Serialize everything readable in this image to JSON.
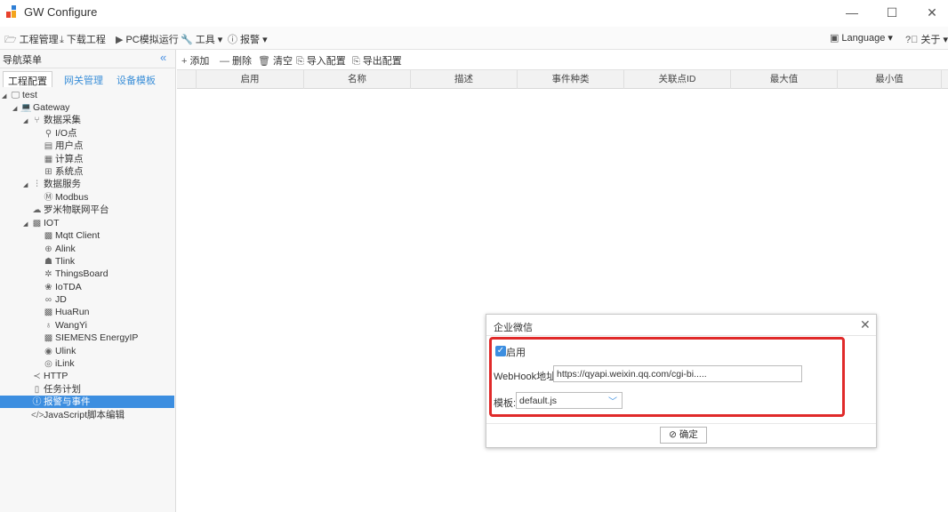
{
  "window": {
    "title": "GW Configure",
    "controls": {
      "minimize": "—",
      "maximize": "☐",
      "close": "✕"
    }
  },
  "menubar": {
    "project": "工程管理",
    "download": "下载工程",
    "pc_sim": "PC模拟运行",
    "tools": "工具",
    "alarm": "报警",
    "language": "Language",
    "about": "关于"
  },
  "nav": {
    "title": "导航菜单",
    "collapse": "«",
    "tabs": [
      "工程配置",
      "网关管理",
      "设备模板"
    ],
    "tree": [
      {
        "label": "test"
      },
      {
        "label": "Gateway"
      },
      {
        "label": "数据采集"
      },
      {
        "label": "I/O点"
      },
      {
        "label": "用户点"
      },
      {
        "label": "计算点"
      },
      {
        "label": "系统点"
      },
      {
        "label": "数据服务"
      },
      {
        "label": "Modbus"
      },
      {
        "label": "罗米物联网平台"
      },
      {
        "label": "IOT"
      },
      {
        "label": "Mqtt Client"
      },
      {
        "label": "Alink"
      },
      {
        "label": "Tlink"
      },
      {
        "label": "ThingsBoard"
      },
      {
        "label": "IoTDA"
      },
      {
        "label": "JD"
      },
      {
        "label": "HuaRun"
      },
      {
        "label": "WangYi"
      },
      {
        "label": "SIEMENS EnergyIP"
      },
      {
        "label": "Ulink"
      },
      {
        "label": "iLink"
      },
      {
        "label": "HTTP"
      },
      {
        "label": "任务计划"
      },
      {
        "label": "报警与事件"
      },
      {
        "label": "JavaScript脚本编辑"
      }
    ]
  },
  "toolbar": {
    "add": "添加",
    "delete": "删除",
    "clear": "清空",
    "import": "导入配置",
    "export": "导出配置"
  },
  "table": {
    "columns": [
      "启用",
      "名称",
      "描述",
      "事件种类",
      "关联点ID",
      "最大值",
      "最小值"
    ]
  },
  "dialog": {
    "title": "企业微信",
    "close": "✕",
    "enable_label": "启用",
    "enable_checked": true,
    "webhook_label": "WebHook地址:",
    "webhook_value": "https://qyapi.weixin.qq.com/cgi-bi.....",
    "template_label": "模板:",
    "template_value": "default.js",
    "ok": "确定"
  },
  "colors": {
    "accent": "#3c8ee0",
    "highlight": "#e02a2a"
  }
}
